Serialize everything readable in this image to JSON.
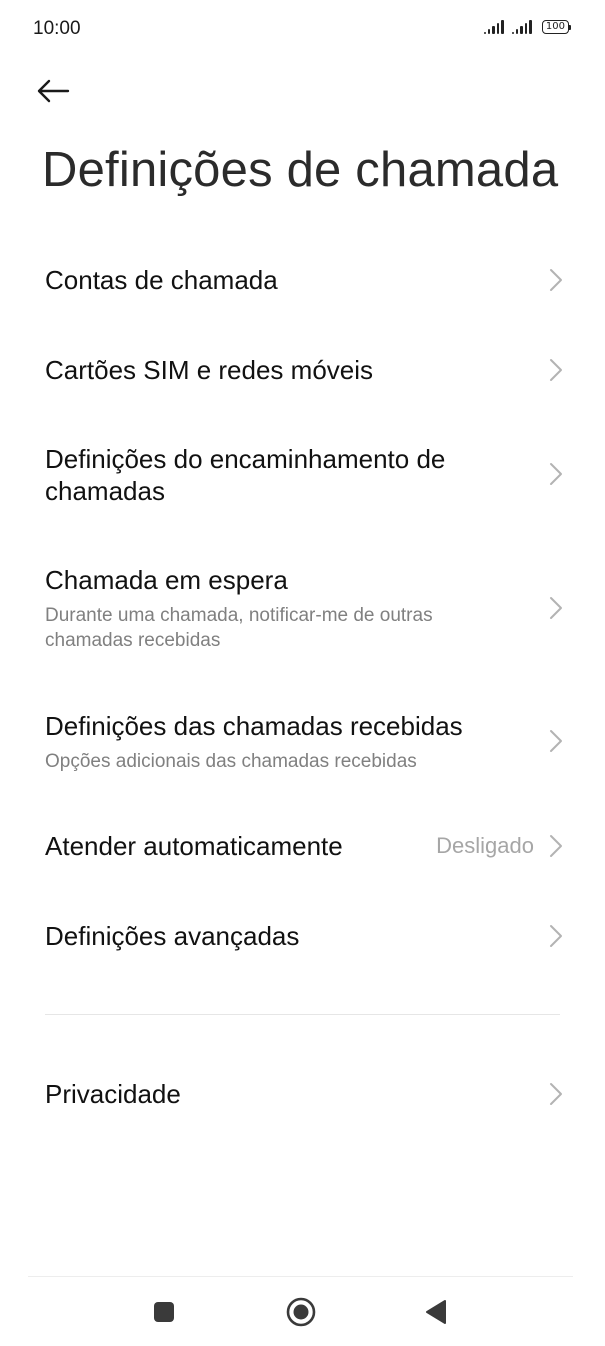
{
  "status_bar": {
    "time": "10:00",
    "battery": "100",
    "icons": [
      "signal-icon",
      "signal-icon",
      "battery-icon"
    ]
  },
  "header": {
    "back_icon": "back-arrow-icon",
    "title": "Definições de chamada"
  },
  "items": [
    {
      "title": "Contas de chamada",
      "subtitle": "",
      "value": ""
    },
    {
      "title": "Cartões SIM e redes móveis",
      "subtitle": "",
      "value": ""
    },
    {
      "title": "Definições do encaminhamento de chamadas",
      "subtitle": "",
      "value": ""
    },
    {
      "title": "Chamada em espera",
      "subtitle": "Durante uma chamada, notificar-me de outras chamadas recebidas",
      "value": ""
    },
    {
      "title": "Definições das chamadas recebidas",
      "subtitle": "Opções adicionais das chamadas recebidas",
      "value": ""
    },
    {
      "title": "Atender automaticamente",
      "subtitle": "",
      "value": "Desligado"
    },
    {
      "title": "Definições avançadas",
      "subtitle": "",
      "value": ""
    },
    {
      "title": "Privacidade",
      "subtitle": "",
      "value": ""
    }
  ],
  "nav_bar": {
    "icons": [
      "recents-square-icon",
      "home-circle-icon",
      "back-triangle-icon"
    ]
  },
  "colors": {
    "background": "#ffffff",
    "title_text": "#111111",
    "subtitle_text": "#808080",
    "value_text": "#a6a6a6",
    "chevron": "#b3b3b3"
  }
}
